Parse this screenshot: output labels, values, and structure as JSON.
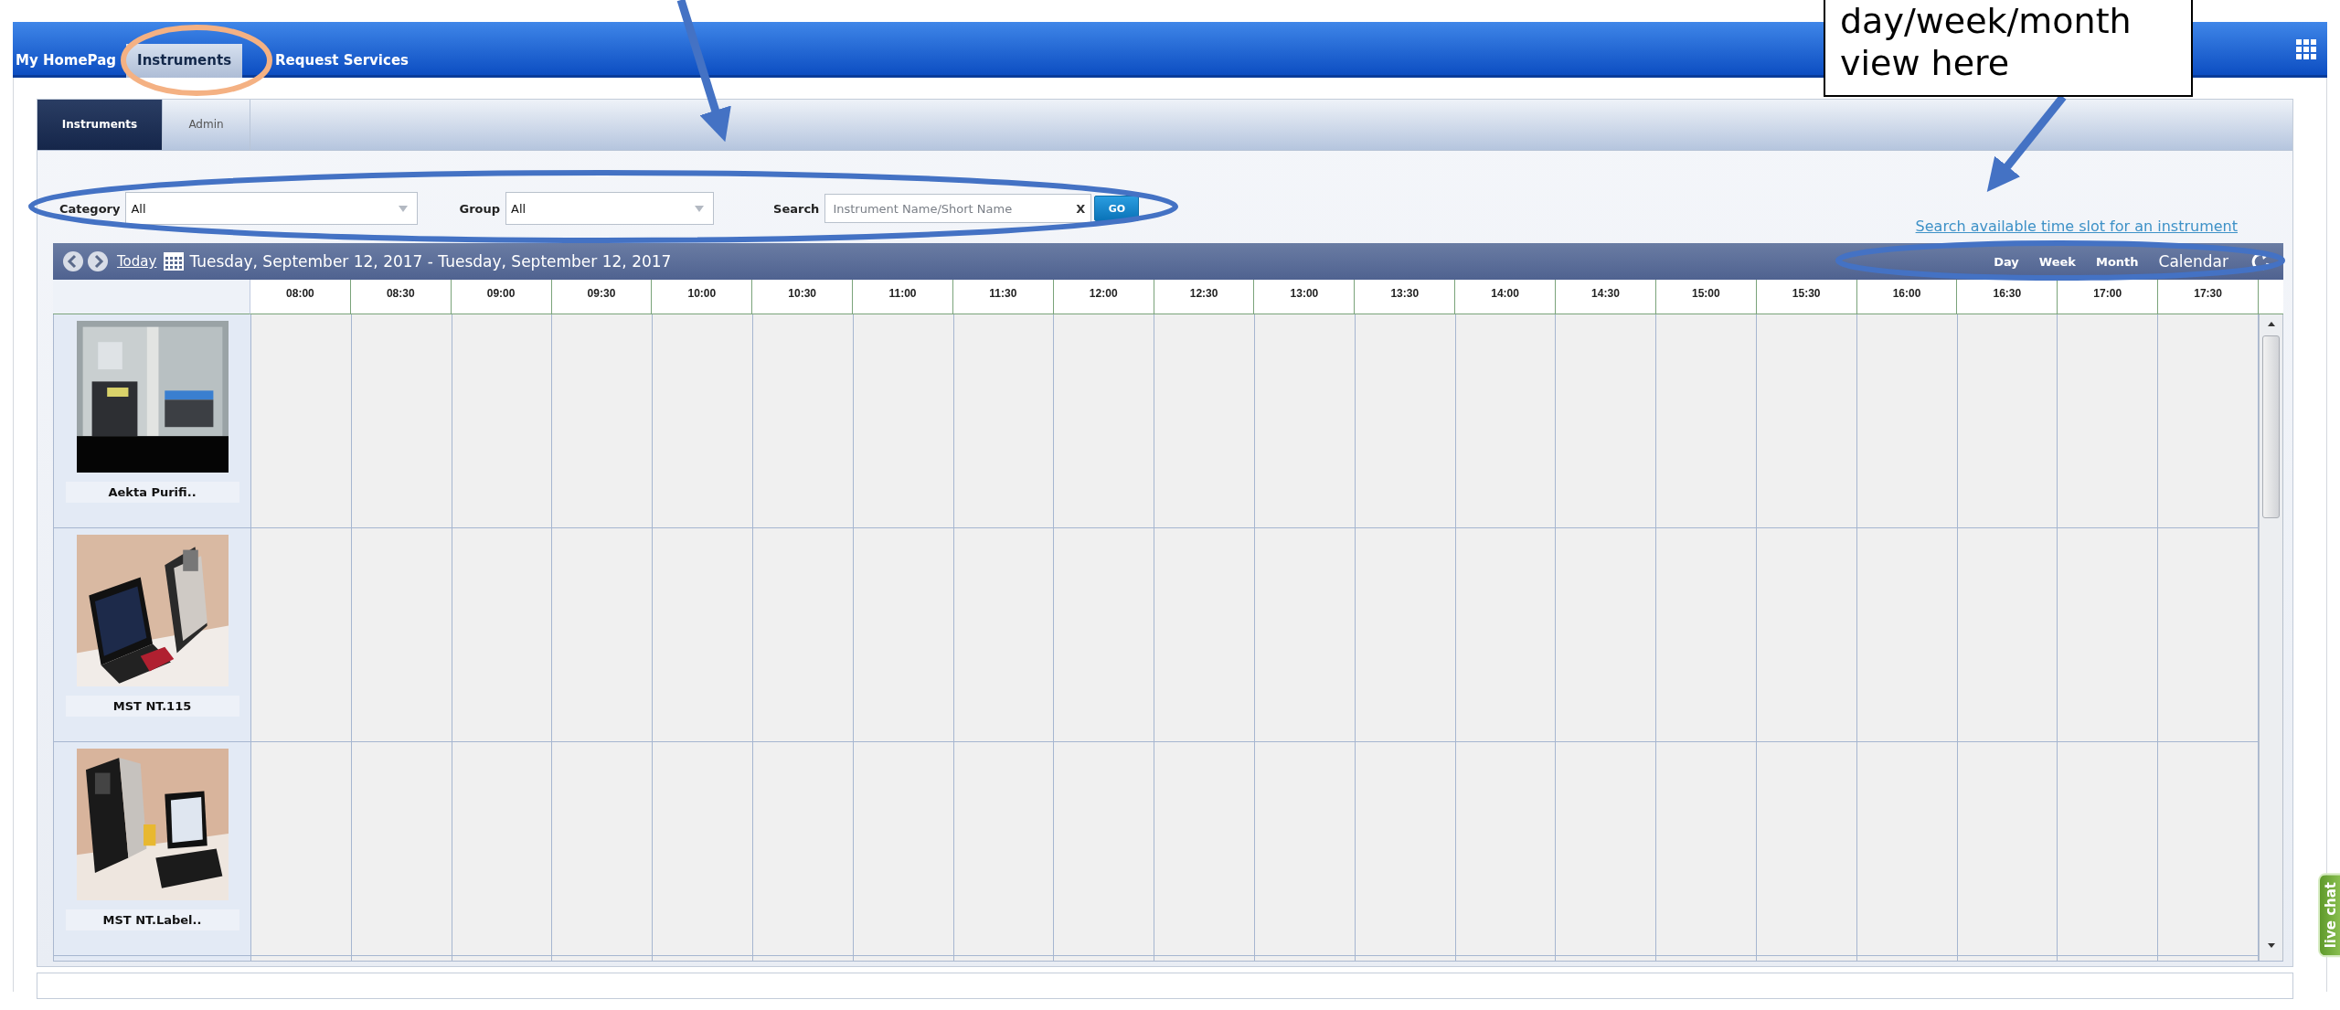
{
  "nav": {
    "tabs": [
      {
        "label": "My HomePag",
        "selected": false
      },
      {
        "label": "Instruments",
        "selected": true
      },
      {
        "label": "Request Services",
        "selected": false
      }
    ]
  },
  "subtabs": [
    {
      "label": "Instruments",
      "selected": true
    },
    {
      "label": "Admin",
      "selected": false
    }
  ],
  "filters": {
    "category": {
      "label": "Category",
      "value": "All"
    },
    "group": {
      "label": "Group",
      "value": "All"
    },
    "search": {
      "label": "Search",
      "placeholder": "Instrument Name/Short Name",
      "clear": "X",
      "button": "GO"
    }
  },
  "availability_link": "Search available time slot for an instrument",
  "toolbar": {
    "today": "Today",
    "date_range": "Tuesday, September 12, 2017 - Tuesday, September 12, 2017",
    "views": [
      {
        "label": "Day"
      },
      {
        "label": "Week"
      },
      {
        "label": "Month"
      },
      {
        "label": "Calendar"
      }
    ]
  },
  "schedule": {
    "times": [
      "08:00",
      "08:30",
      "09:00",
      "09:30",
      "10:00",
      "10:30",
      "11:00",
      "11:30",
      "12:00",
      "12:30",
      "13:00",
      "13:30",
      "14:00",
      "14:30",
      "15:00",
      "15:30",
      "16:00",
      "16:30",
      "17:00",
      "17:30"
    ],
    "instruments": [
      {
        "name": "Aekta Purifi..",
        "kind": "picture"
      },
      {
        "name": "MST NT.115",
        "kind": "picture"
      },
      {
        "name": "MST NT.Label..",
        "kind": "picture"
      }
    ]
  },
  "live_chat": "live chat",
  "annotation": {
    "callout": "day/week/month view here"
  }
}
